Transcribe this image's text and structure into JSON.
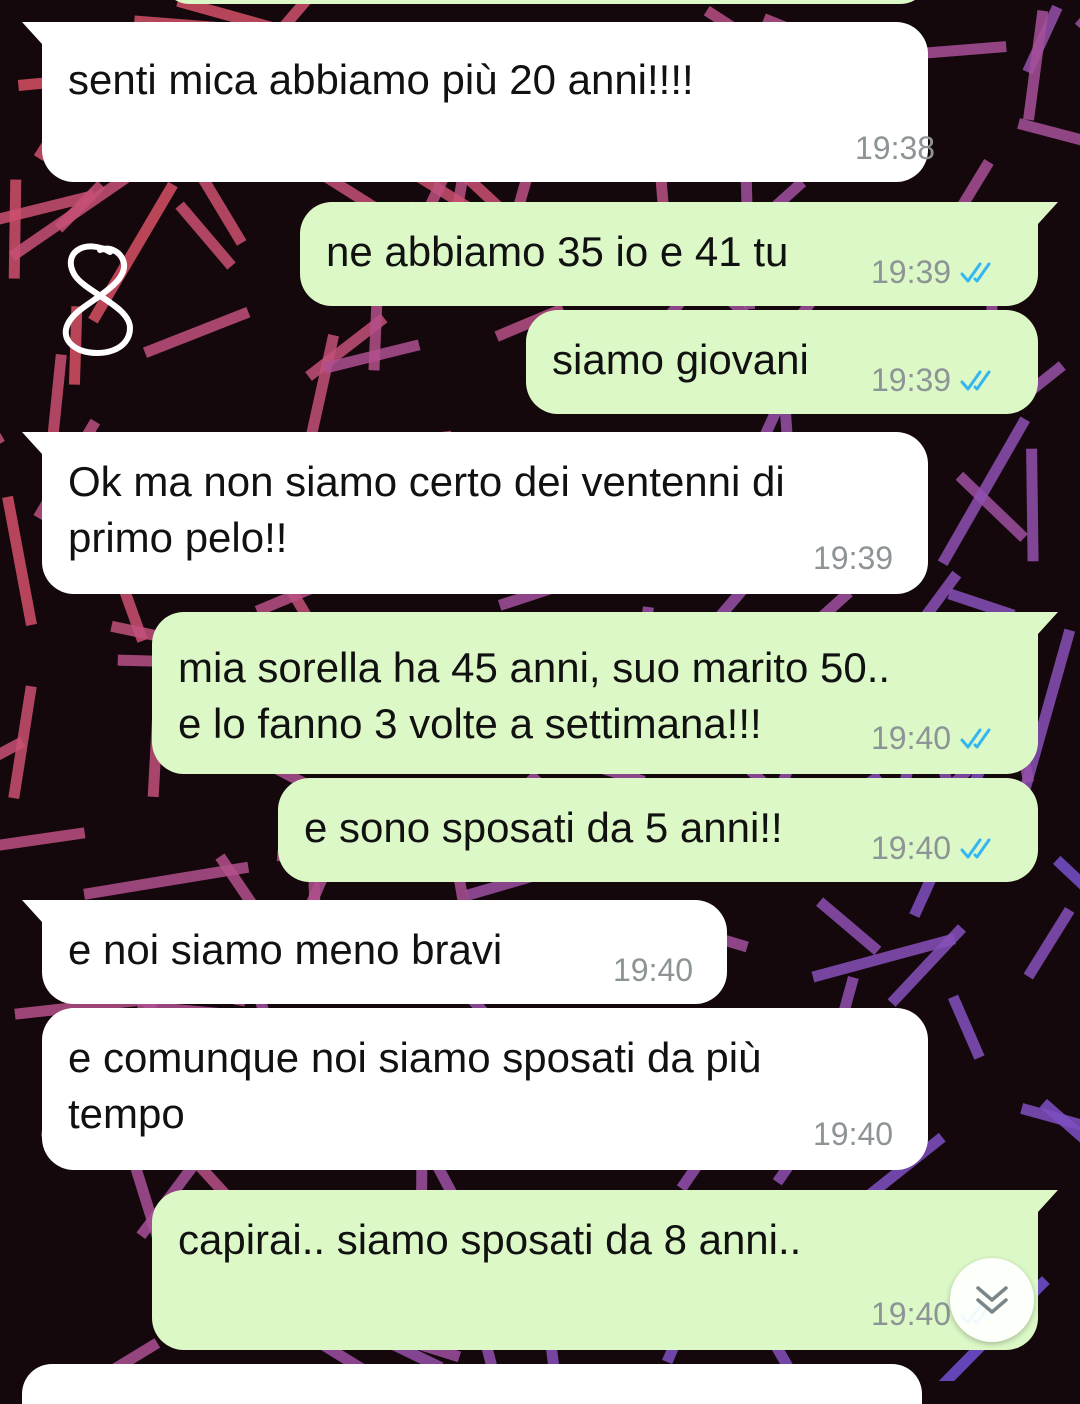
{
  "colors": {
    "incoming_bubble": "#ffffff",
    "outgoing_bubble": "#dcf8c6",
    "read_ticks": "#34b7f1",
    "timestamp": "#8d9496"
  },
  "messages": [
    {
      "direction": "in",
      "text_lines": [
        "senti mica abbiamo più 20 anni!!!!"
      ],
      "time": "19:38"
    },
    {
      "direction": "out",
      "text_lines": [
        "ne abbiamo 35 io e 41 tu"
      ],
      "time": "19:39",
      "status": "read"
    },
    {
      "direction": "out",
      "text_lines": [
        "siamo giovani"
      ],
      "time": "19:39",
      "status": "read"
    },
    {
      "direction": "in",
      "text_lines": [
        "Ok ma non siamo certo dei ventenni di",
        "primo pelo!!"
      ],
      "time": "19:39"
    },
    {
      "direction": "out",
      "text_lines": [
        "mia sorella ha 45 anni, suo marito 50..",
        "e lo fanno 3 volte a settimana!!!"
      ],
      "time": "19:40",
      "status": "read"
    },
    {
      "direction": "out",
      "text_lines": [
        "e sono sposati da 5 anni!!"
      ],
      "time": "19:40",
      "status": "read"
    },
    {
      "direction": "in",
      "text_lines": [
        "e noi siamo meno bravi"
      ],
      "time": "19:40"
    },
    {
      "direction": "in",
      "text_lines": [
        "e comunque noi siamo sposati da più",
        "tempo"
      ],
      "time": "19:40"
    },
    {
      "direction": "out",
      "text_lines": [
        "capirai.. siamo sposati da 8 anni.."
      ],
      "time": "19:40",
      "status": "read"
    }
  ],
  "icons": {
    "read_status": "double-check-icon",
    "scroll_button": "chevron-double-down-icon",
    "doodle": "handwritten-eight-doodle"
  }
}
